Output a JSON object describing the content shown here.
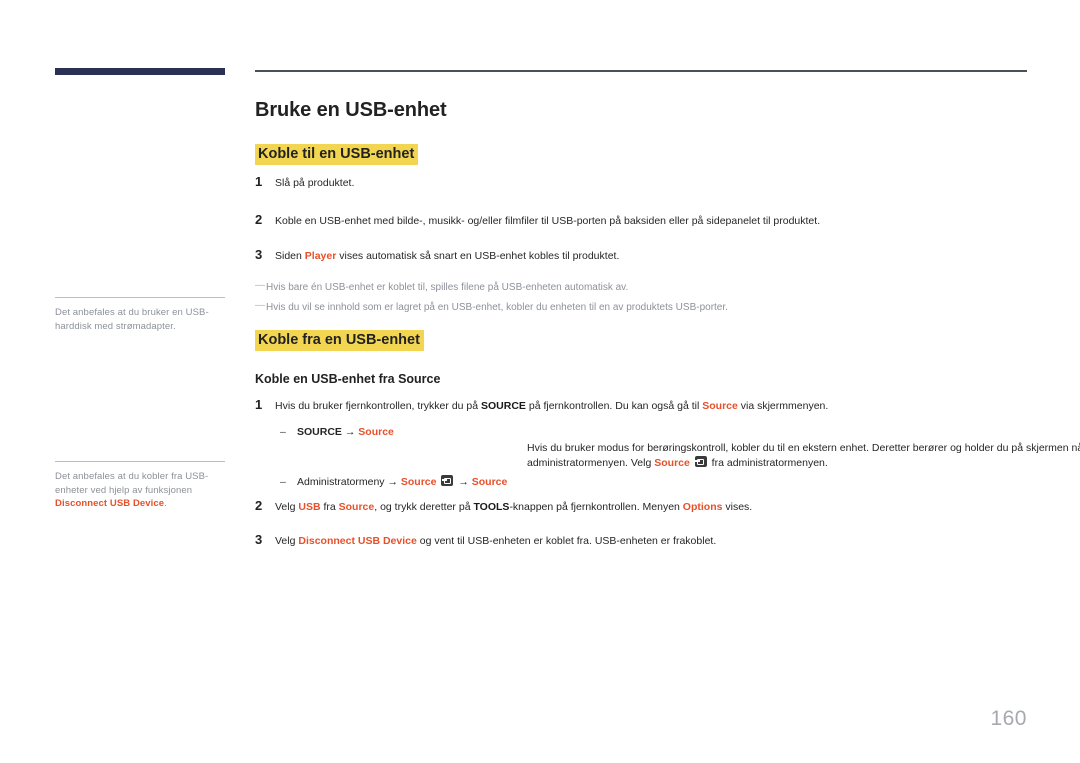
{
  "document": {
    "page_number": "160",
    "colors": {
      "accent": "#e8502a",
      "highlight": "#f2d651",
      "brand_bar": "#2b3152",
      "side_note_text": "#8d9199"
    }
  },
  "sidebar": {
    "notes": [
      {
        "id": "note-usb-harddisk",
        "text": "Det anbefales at du bruker en USB-harddisk med strømadapter."
      },
      {
        "id": "note-disconnect",
        "text_before": "Det anbefales at du kobler fra USB-enheter ved hjelp av funksjonen ",
        "accent_term": "Disconnect USB Device",
        "text_after": "."
      }
    ]
  },
  "main": {
    "title": "Bruke en USB-enhet",
    "sections": [
      {
        "id": "koble-til",
        "heading": "Koble til en USB-enhet",
        "steps": [
          {
            "num": "1",
            "text": "Slå på produktet."
          },
          {
            "num": "2",
            "text": "Koble en USB-enhet med bilde-, musikk- og/eller filmfiler til USB-porten på baksiden eller på sidepanelet til produktet."
          },
          {
            "num": "3",
            "text_before": "Siden ",
            "accent_term": "Player",
            "text_after": " vises automatisk så snart en USB-enhet kobles til produktet."
          }
        ],
        "notes": [
          "Hvis bare én USB-enhet er koblet til, spilles filene på USB-enheten automatisk av.",
          "Hvis du vil se innhold som er lagret på en USB-enhet, kobler du enheten til en av produktets USB-porter."
        ]
      },
      {
        "id": "koble-fra",
        "heading": "Koble fra en USB-enhet",
        "sub_heading": "Koble en USB-enhet fra Source",
        "step1": {
          "num": "1",
          "part_a": "Hvis du bruker fjernkontrollen, trykker du på ",
          "bold_key": "SOURCE",
          "part_b": " på fjernkontrollen. Du kan også gå til ",
          "accent_1": "Source",
          "part_c": " via skjermmenyen."
        },
        "bullet1": {
          "marker": "–",
          "bold_key": "SOURCE",
          "arrow": "→",
          "accent_1": "Source"
        },
        "paragraph": {
          "part_a": "Hvis du bruker modus for berøringskontroll, kobler du til en ekstern enhet. Deretter berører og holder du på skjermen når produktet slås på, for å vise administratormenyen. Velg ",
          "accent_1": "Source",
          "icon": "source-key-icon",
          "part_b": " fra administratormenyen."
        },
        "bullet2": {
          "marker": "–",
          "label": "Administratormeny",
          "arrow_1": "→",
          "accent_1": "Source",
          "icon": "source-key-icon",
          "arrow_2": "→",
          "accent_2": "Source"
        },
        "step2": {
          "num": "2",
          "part_a": "Velg ",
          "accent_1": "USB",
          "part_b": " fra ",
          "accent_2": "Source",
          "part_c": ", og trykk deretter på ",
          "bold_key": "TOOLS",
          "part_d": "-knappen på fjernkontrollen. Menyen ",
          "accent_3": "Options",
          "part_e": " vises."
        },
        "step3": {
          "num": "3",
          "part_a": "Velg ",
          "accent_1": "Disconnect USB Device",
          "part_b": " og vent til USB-enheten er koblet fra. USB-enheten er frakoblet."
        }
      }
    ]
  }
}
